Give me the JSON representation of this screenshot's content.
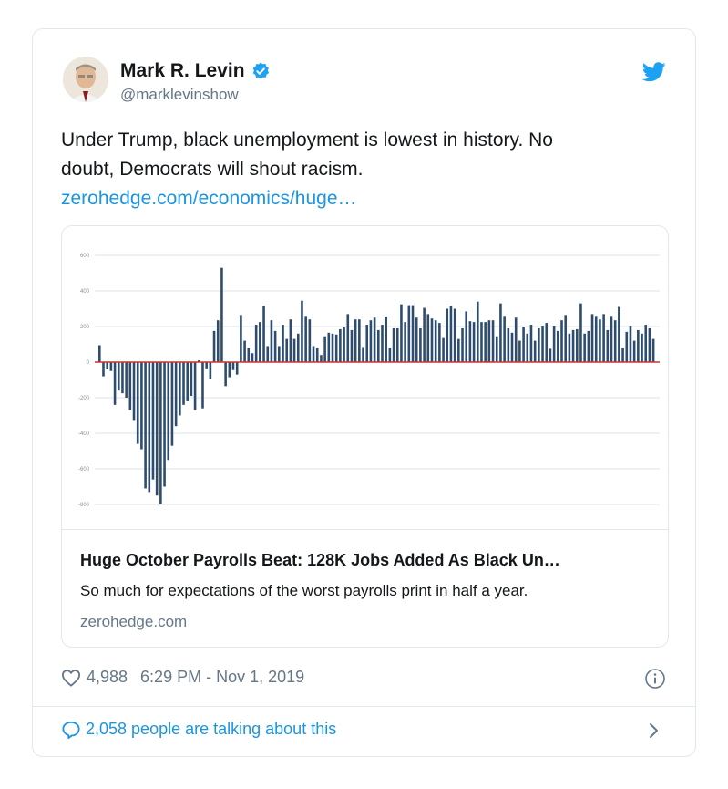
{
  "author": {
    "display_name": "Mark R. Levin",
    "handle": "@marklevinshow",
    "verified": true
  },
  "tweet": {
    "line1": "Under Trump, black unemployment is lowest in history.  No",
    "line2": "doubt, Democrats will shout racism.",
    "link": "zerohedge.com/economics/huge…"
  },
  "card": {
    "title": "Huge October Payrolls Beat: 128K Jobs Added As Black Un…",
    "description": "So much for expectations of the worst payrolls print in half a year.",
    "domain": "zerohedge.com"
  },
  "meta": {
    "likes": "4,988",
    "timestamp": "6:29 PM - Nov 1, 2019"
  },
  "talking": {
    "label": "2,058 people are talking about this"
  },
  "colors": {
    "link": "#1b95e0",
    "bar": "#2e4d6e",
    "zero_line": "#cc3333",
    "grid": "#dde3ea"
  },
  "icons": [
    "verified-badge-icon",
    "twitter-bird-icon",
    "heart-icon",
    "info-icon",
    "speech-bubble-icon",
    "chevron-right-icon"
  ],
  "chart_data": {
    "type": "bar",
    "yticks": [
      600,
      400,
      200,
      0,
      -200,
      -400,
      -600,
      -800
    ],
    "ylim": [
      -800,
      600
    ],
    "grid": true,
    "values": [
      95,
      -80,
      -40,
      -50,
      -240,
      -160,
      -175,
      -200,
      -270,
      -330,
      -460,
      -490,
      -710,
      -730,
      -660,
      -750,
      -800,
      -700,
      -550,
      -470,
      -360,
      -300,
      -240,
      -220,
      -190,
      -270,
      10,
      -260,
      -35,
      -95,
      175,
      235,
      530,
      -135,
      -85,
      -45,
      -70,
      265,
      120,
      80,
      50,
      210,
      225,
      315,
      90,
      235,
      175,
      90,
      210,
      130,
      240,
      130,
      160,
      345,
      260,
      240,
      90,
      80,
      40,
      145,
      165,
      160,
      155,
      185,
      195,
      270,
      180,
      240,
      240,
      85,
      210,
      235,
      250,
      180,
      210,
      255,
      80,
      190,
      190,
      325,
      225,
      320,
      320,
      250,
      190,
      305,
      270,
      245,
      235,
      220,
      135,
      300,
      315,
      300,
      130,
      190,
      285,
      230,
      225,
      340,
      225,
      225,
      235,
      235,
      145,
      330,
      260,
      190,
      165,
      250,
      120,
      200,
      160,
      210,
      120,
      190,
      205,
      220,
      75,
      205,
      175,
      235,
      265,
      160,
      180,
      185,
      330,
      160,
      175,
      270,
      260,
      240,
      270,
      180,
      260,
      235,
      310,
      80,
      170,
      205,
      120,
      180,
      160,
      210,
      190,
      130
    ]
  }
}
